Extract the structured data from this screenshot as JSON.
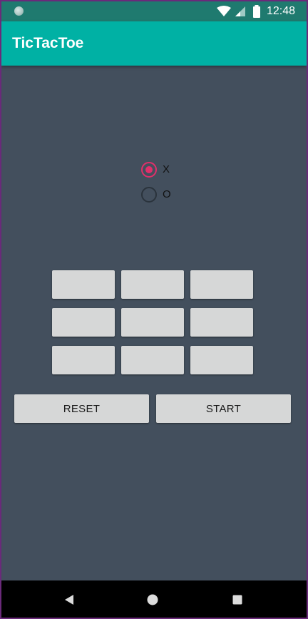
{
  "status_bar": {
    "time": "12:48",
    "icons": [
      "notification-dot-icon",
      "wifi-icon",
      "cell-signal-icon",
      "battery-icon"
    ]
  },
  "app_bar": {
    "title": "TicTacToe"
  },
  "player_choice": {
    "options": [
      {
        "label": "X",
        "selected": true
      },
      {
        "label": "O",
        "selected": false
      }
    ]
  },
  "board": {
    "cells": [
      "",
      "",
      "",
      "",
      "",
      "",
      "",
      "",
      ""
    ]
  },
  "actions": {
    "reset_label": "RESET",
    "start_label": "START"
  },
  "nav_bar": {
    "icons": [
      "back-icon",
      "home-icon",
      "recents-icon"
    ]
  },
  "colors": {
    "app_bar": "#00b1a4",
    "status_bar": "#1f7a6f",
    "background": "#434f5d",
    "accent": "#e0306a",
    "button": "#d6d7d7"
  }
}
